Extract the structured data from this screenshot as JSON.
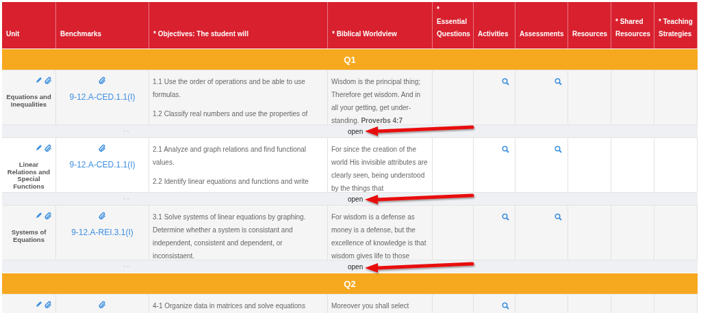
{
  "columns": [
    "Unit",
    "Benchmarks",
    "* Objectives: The student will",
    "* Biblical Worldview",
    "* Essential Questions",
    "Activities",
    "Assessments",
    "Resources",
    "* Shared Resources",
    "* Teaching Strategies"
  ],
  "sections": [
    {
      "label": "Q1",
      "rows": [
        {
          "unit": "Equations and Inequalities",
          "benchmark": "9-12.A-CED.1.1(I)",
          "objectives": [
            "1.1 Use the order of operations and be able to use formulas.",
            "1.2 Classify real numbers and use the properties of"
          ],
          "worldview": "Wisdom is the principal thing; Therefore get wisdom. And in all your getting, get under-standing. **Proverbs 4:7**",
          "activities_search": true,
          "assessments_search": true,
          "open_label": "open"
        },
        {
          "unit": "Linear Relations and Special Functions",
          "benchmark": "9-12.A-CED.1.1(I)",
          "objectives": [
            "2.1 Analyze and graph relations and find functional values.",
            "2.2 Identify linear equations and functions and write"
          ],
          "worldview": "For since the creation of the world His invisible attributes are clearly seen, being understood by the things that",
          "activities_search": true,
          "assessments_search": true,
          "open_label": "open"
        },
        {
          "unit": "Systems of Equations",
          "benchmark": "9-12.A-REI.3.1(I)",
          "objectives": [
            "3.1 Solve systems of linear equations by graphing. Determine whether a system is consistant and independent, consistent and dependent, or inconsistaent."
          ],
          "worldview": "For wisdom is a defense as money is a defense, but the excellence of knowledge is that wisdom gives life to those",
          "activities_search": true,
          "assessments_search": true,
          "open_label": "open"
        }
      ]
    },
    {
      "label": "Q2",
      "rows": [
        {
          "unit": "",
          "benchmark": "",
          "objectives": [
            "4-1 Organize data in matrices and solve equations"
          ],
          "worldview": "Moreover you shall select",
          "activities_search": true,
          "assessments_search": false
        }
      ]
    }
  ]
}
